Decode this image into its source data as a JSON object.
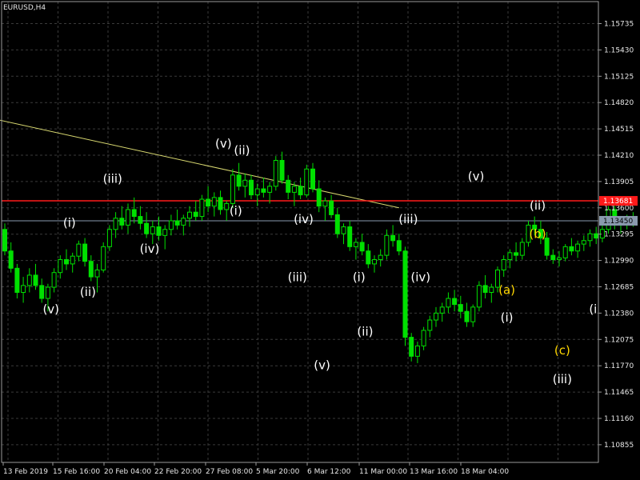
{
  "chart_data": {
    "type": "line",
    "title": "EURUSD,H4",
    "xlabel": "",
    "ylabel": "",
    "grid": true,
    "colors": {
      "background": "#000000",
      "grid": "#3a3a3a",
      "axis": "#9a9a9a",
      "candle": "#00e000",
      "trendline": "#d8d870",
      "resistance": "#ff1a1a",
      "current_price_line": "#8a9aae",
      "wave_label_white": "#ffffff",
      "wave_label_yellow": "#ffd700"
    },
    "y_ticks": [
      "1.15735",
      "1.15430",
      "1.15125",
      "1.14820",
      "1.14515",
      "1.14210",
      "1.13905",
      "1.13600",
      "1.13295",
      "1.12990",
      "1.12685",
      "1.12380",
      "1.12075",
      "1.11770",
      "1.11465",
      "1.11160",
      "1.10855"
    ],
    "ylim": [
      1.1065,
      1.1599
    ],
    "x_ticks": [
      "13 Feb 2019",
      "15 Feb 16:00",
      "20 Feb 04:00",
      "22 Feb 20:00",
      "27 Feb 08:00",
      "5 Mar 20:00",
      "6 Mar 12:00",
      "11 Mar 00:00",
      "13 Mar 16:00",
      "18 Mar 04:00"
    ],
    "series": [
      {
        "type": "candles",
        "values": [
          [
            1.1335,
            1.1342,
            1.1305,
            1.131
          ],
          [
            1.131,
            1.132,
            1.1285,
            1.129
          ],
          [
            1.129,
            1.1295,
            1.1255,
            1.1262
          ],
          [
            1.1262,
            1.128,
            1.125,
            1.127
          ],
          [
            1.127,
            1.129,
            1.1262,
            1.1282
          ],
          [
            1.1282,
            1.1295,
            1.1265,
            1.127
          ],
          [
            1.127,
            1.1278,
            1.125,
            1.1255
          ],
          [
            1.1255,
            1.1272,
            1.124,
            1.1268
          ],
          [
            1.1268,
            1.129,
            1.1262,
            1.1285
          ],
          [
            1.1285,
            1.1305,
            1.1278,
            1.13
          ],
          [
            1.13,
            1.1312,
            1.1288,
            1.1295
          ],
          [
            1.1295,
            1.1308,
            1.1285,
            1.1304
          ],
          [
            1.1304,
            1.1322,
            1.1298,
            1.1318
          ],
          [
            1.1318,
            1.1325,
            1.1292,
            1.1298
          ],
          [
            1.1298,
            1.1305,
            1.1275,
            1.128
          ],
          [
            1.128,
            1.1295,
            1.1262,
            1.1288
          ],
          [
            1.1288,
            1.132,
            1.1285,
            1.1315
          ],
          [
            1.1315,
            1.134,
            1.131,
            1.1335
          ],
          [
            1.1335,
            1.1355,
            1.1325,
            1.1348
          ],
          [
            1.1348,
            1.1362,
            1.1335,
            1.134
          ],
          [
            1.134,
            1.1365,
            1.133,
            1.1358
          ],
          [
            1.1358,
            1.1372,
            1.1342,
            1.135
          ],
          [
            1.135,
            1.1362,
            1.1335,
            1.1342
          ],
          [
            1.1342,
            1.1355,
            1.1325,
            1.133
          ],
          [
            1.133,
            1.1345,
            1.1318,
            1.1338
          ],
          [
            1.1338,
            1.135,
            1.1322,
            1.1328
          ],
          [
            1.1328,
            1.134,
            1.1312,
            1.1335
          ],
          [
            1.1335,
            1.1352,
            1.1328,
            1.1345
          ],
          [
            1.1345,
            1.1358,
            1.1335,
            1.134
          ],
          [
            1.134,
            1.1352,
            1.1328,
            1.1348
          ],
          [
            1.1348,
            1.1362,
            1.1338,
            1.1355
          ],
          [
            1.1355,
            1.1368,
            1.1345,
            1.135
          ],
          [
            1.135,
            1.1375,
            1.1345,
            1.137
          ],
          [
            1.137,
            1.1385,
            1.1355,
            1.1362
          ],
          [
            1.1362,
            1.1378,
            1.135,
            1.1372
          ],
          [
            1.1372,
            1.138,
            1.1352,
            1.1358
          ],
          [
            1.1358,
            1.1368,
            1.1345,
            1.1365
          ],
          [
            1.1365,
            1.1405,
            1.136,
            1.1398
          ],
          [
            1.1398,
            1.1412,
            1.138,
            1.1385
          ],
          [
            1.1385,
            1.14,
            1.1372,
            1.1392
          ],
          [
            1.1392,
            1.1398,
            1.137,
            1.1375
          ],
          [
            1.1375,
            1.1388,
            1.1362,
            1.1382
          ],
          [
            1.1382,
            1.1395,
            1.1372,
            1.1378
          ],
          [
            1.1378,
            1.139,
            1.1365,
            1.1385
          ],
          [
            1.1385,
            1.142,
            1.138,
            1.1415
          ],
          [
            1.1415,
            1.1425,
            1.1388,
            1.1392
          ],
          [
            1.1392,
            1.1398,
            1.137,
            1.1378
          ],
          [
            1.1378,
            1.139,
            1.1362,
            1.1385
          ],
          [
            1.1385,
            1.1395,
            1.137,
            1.1375
          ],
          [
            1.1375,
            1.141,
            1.1372,
            1.1405
          ],
          [
            1.1405,
            1.1412,
            1.1378,
            1.1382
          ],
          [
            1.1382,
            1.1392,
            1.1355,
            1.1362
          ],
          [
            1.1362,
            1.1372,
            1.1345,
            1.1368
          ],
          [
            1.1368,
            1.1375,
            1.1348,
            1.1352
          ],
          [
            1.1352,
            1.136,
            1.1325,
            1.133
          ],
          [
            1.133,
            1.1342,
            1.1318,
            1.1338
          ],
          [
            1.1338,
            1.1345,
            1.131,
            1.1315
          ],
          [
            1.1315,
            1.1325,
            1.13,
            1.132
          ],
          [
            1.132,
            1.133,
            1.1305,
            1.131
          ],
          [
            1.131,
            1.1318,
            1.129,
            1.1295
          ],
          [
            1.1295,
            1.1305,
            1.1285,
            1.13
          ],
          [
            1.13,
            1.1312,
            1.1292,
            1.1305
          ],
          [
            1.1305,
            1.1335,
            1.13,
            1.1328
          ],
          [
            1.1328,
            1.134,
            1.1315,
            1.1322
          ],
          [
            1.1322,
            1.133,
            1.1305,
            1.131
          ],
          [
            1.131,
            1.1315,
            1.12,
            1.121
          ],
          [
            1.121,
            1.1215,
            1.1182,
            1.1188
          ],
          [
            1.1188,
            1.1205,
            1.118,
            1.12
          ],
          [
            1.12,
            1.1222,
            1.1195,
            1.1218
          ],
          [
            1.1218,
            1.1235,
            1.121,
            1.123
          ],
          [
            1.123,
            1.1245,
            1.1222,
            1.1238
          ],
          [
            1.1238,
            1.125,
            1.1228,
            1.1245
          ],
          [
            1.1245,
            1.1262,
            1.1238,
            1.1255
          ],
          [
            1.1255,
            1.1265,
            1.124,
            1.1248
          ],
          [
            1.1248,
            1.1258,
            1.1232,
            1.124
          ],
          [
            1.124,
            1.125,
            1.1222,
            1.1228
          ],
          [
            1.1228,
            1.1248,
            1.1222,
            1.1245
          ],
          [
            1.1245,
            1.1275,
            1.124,
            1.127
          ],
          [
            1.127,
            1.1282,
            1.1255,
            1.1262
          ],
          [
            1.1262,
            1.1272,
            1.125,
            1.1268
          ],
          [
            1.1268,
            1.1292,
            1.1262,
            1.1288
          ],
          [
            1.1288,
            1.1305,
            1.128,
            1.13
          ],
          [
            1.13,
            1.1312,
            1.129,
            1.1308
          ],
          [
            1.1308,
            1.132,
            1.1298,
            1.1305
          ],
          [
            1.1305,
            1.1325,
            1.13,
            1.132
          ],
          [
            1.132,
            1.1345,
            1.1315,
            1.134
          ],
          [
            1.134,
            1.135,
            1.1328,
            1.1335
          ],
          [
            1.1335,
            1.1345,
            1.1318,
            1.1325
          ],
          [
            1.1325,
            1.1332,
            1.13,
            1.1305
          ],
          [
            1.1305,
            1.1312,
            1.1295,
            1.13
          ],
          [
            1.13,
            1.131,
            1.1292,
            1.1302
          ],
          [
            1.1302,
            1.1318,
            1.1298,
            1.1315
          ],
          [
            1.1315,
            1.1325,
            1.1305,
            1.131
          ],
          [
            1.131,
            1.1322,
            1.1302,
            1.1318
          ],
          [
            1.1318,
            1.1328,
            1.131,
            1.1322
          ],
          [
            1.1322,
            1.1335,
            1.1315,
            1.133
          ],
          [
            1.133,
            1.1338,
            1.1318,
            1.1325
          ],
          [
            1.1325,
            1.134,
            1.132,
            1.1335
          ],
          [
            1.1335,
            1.1362,
            1.133,
            1.1358
          ],
          [
            1.1358,
            1.1365,
            1.1335,
            1.134
          ],
          [
            1.134,
            1.135,
            1.133,
            1.1345
          ],
          [
            1.1345,
            1.1352,
            1.1335,
            1.1348
          ],
          [
            1.1348,
            1.1355,
            1.1338,
            1.1345
          ]
        ]
      },
      {
        "type": "trendline",
        "x": [
          -3,
          64
        ],
        "y": [
          1.1465,
          1.136
        ]
      },
      {
        "type": "hline",
        "name": "resistance",
        "value": 1.13681
      },
      {
        "type": "hline",
        "name": "current",
        "value": 1.1345
      }
    ],
    "price_labels": [
      {
        "text": "1.13681",
        "color": "#ff1a1a",
        "value": 1.13681
      },
      {
        "text": "1.13450",
        "color": "#8a9aae",
        "value": 1.1345
      }
    ],
    "wave_labels": [
      {
        "text": ")",
        "t": -1.5,
        "p": 1.1345,
        "color": "#ffffff"
      },
      {
        "text": "(i)",
        "t": 10.5,
        "p": 1.1338,
        "color": "#ffffff"
      },
      {
        "text": "(v)",
        "t": 7.5,
        "p": 1.1238,
        "color": "#ffffff"
      },
      {
        "text": "(ii)",
        "t": 13.5,
        "p": 1.1258,
        "color": "#ffffff"
      },
      {
        "text": "(iii)",
        "t": 17.5,
        "p": 1.1389,
        "color": "#ffffff"
      },
      {
        "text": "(iv)",
        "t": 23.5,
        "p": 1.1308,
        "color": "#ffffff"
      },
      {
        "text": "(v)",
        "t": 35.5,
        "p": 1.143,
        "color": "#ffffff"
      },
      {
        "text": "(ii)",
        "t": 38.5,
        "p": 1.1422,
        "color": "#ffffff"
      },
      {
        "text": "(i)",
        "t": 37.5,
        "p": 1.1352,
        "color": "#ffffff"
      },
      {
        "text": "(iv)",
        "t": 48.5,
        "p": 1.1342,
        "color": "#ffffff"
      },
      {
        "text": "(iii)",
        "t": 47.5,
        "p": 1.1275,
        "color": "#ffffff"
      },
      {
        "text": "(v)",
        "t": 51.5,
        "p": 1.1173,
        "color": "#ffffff"
      },
      {
        "text": "(i)",
        "t": 57.5,
        "p": 1.1275,
        "color": "#ffffff"
      },
      {
        "text": "(ii)",
        "t": 58.5,
        "p": 1.1212,
        "color": "#ffffff"
      },
      {
        "text": "(iii)",
        "t": 65.5,
        "p": 1.1342,
        "color": "#ffffff"
      },
      {
        "text": "(iv)",
        "t": 67.5,
        "p": 1.1275,
        "color": "#ffffff"
      },
      {
        "text": "(v)",
        "t": 76.5,
        "p": 1.1392,
        "color": "#ffffff"
      },
      {
        "text": "(ii)",
        "t": 86.5,
        "p": 1.1358,
        "color": "#ffffff"
      },
      {
        "text": "(b)",
        "t": 86.5,
        "p": 1.1325,
        "color": "#ffd700"
      },
      {
        "text": "(a)",
        "t": 81.5,
        "p": 1.126,
        "color": "#ffd700"
      },
      {
        "text": "(i)",
        "t": 81.5,
        "p": 1.1228,
        "color": "#ffffff"
      },
      {
        "text": "(c)",
        "t": 90.5,
        "p": 1.119,
        "color": "#ffd700"
      },
      {
        "text": "(iii)",
        "t": 90.5,
        "p": 1.1157,
        "color": "#ffffff"
      },
      {
        "text": "(i",
        "t": 95.5,
        "p": 1.1238,
        "color": "#ffffff"
      }
    ]
  }
}
